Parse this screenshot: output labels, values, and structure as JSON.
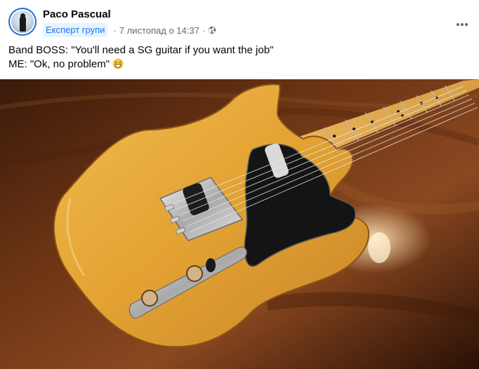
{
  "post": {
    "author": "Paco Pascual",
    "badge": "Експерт групи",
    "timestamp": "7 листопад о 14:37",
    "separator": "·",
    "privacy_icon": "globe-icon",
    "more_icon": "more-dots-icon",
    "text_line1": "Band BOSS: \"You'll need a SG guitar if you want the job\"",
    "text_line2": "ME: \"Ok, no problem\"",
    "emoji_icon": "grinning-sweat-emoji-icon"
  },
  "colors": {
    "accent": "#1877f2",
    "badge_bg": "#e7f3ff",
    "secondary_text": "#65676b",
    "guitar_body": "#e3a93c",
    "pickguard": "#111111",
    "table_wood": "#5a2a10"
  }
}
